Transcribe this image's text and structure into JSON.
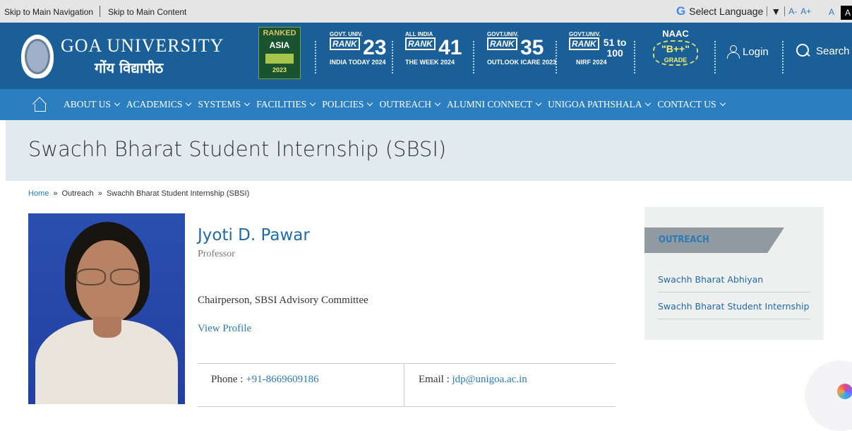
{
  "topbar": {
    "skip_nav": "Skip to Main Navigation",
    "skip_content": "Skip to Main Content",
    "language": "Select Language",
    "language_arrow": "▼",
    "font_small": "A-",
    "font_large": "A+",
    "font_normal": "A",
    "font_dark": "A"
  },
  "header": {
    "university_name": "GOA UNIVERSITY",
    "university_name_hindi": "गोंय विद्यापीठ",
    "rank_asia": {
      "ranked": "RANKED",
      "region": "ASIA",
      "year": "2023"
    },
    "rankings": [
      {
        "top": "GOVT. UNIV.",
        "rank_label": "RANK",
        "value": "23",
        "caption": "INDIA TODAY 2024"
      },
      {
        "top": "ALL INDIA",
        "rank_label": "RANK",
        "value": "41",
        "caption": "THE WEEK 2024"
      },
      {
        "top": "GOVT.UNIV.",
        "rank_label": "RANK",
        "value": "35",
        "caption": "OUTLOOK ICARE 2023"
      },
      {
        "top": "GOVT.UNIV.",
        "rank_label": "RANK",
        "value": "51 to 100",
        "caption": "NIRF 2024"
      }
    ],
    "naac": {
      "title": "NAAC",
      "grade": "\"B++\"",
      "grade_label": "GRADE"
    },
    "login_label": "Login",
    "search_label": "Search"
  },
  "nav": {
    "items": [
      "ABOUT US",
      "ACADEMICS",
      "SYSTEMS",
      "FACILITIES",
      "POLICIES",
      "OUTREACH",
      "ALUMNI CONNECT",
      "UNIGOA PATHSHALA",
      "CONTACT US"
    ]
  },
  "page": {
    "title": "Swachh Bharat Student Internship (SBSI)",
    "breadcrumb": [
      "Home",
      "Outreach",
      "Swachh Bharat Student Internship (SBSI)"
    ],
    "breadcrumb_sep": "»"
  },
  "profile": {
    "name": "Jyoti D. Pawar",
    "designation": "Professor",
    "role": "Chairperson, SBSI Advisory Committee",
    "view_profile": "View Profile",
    "phone_label": "Phone :",
    "phone": "+91-8669609186",
    "email_label": "Email :",
    "email": "jdp@unigoa.ac.in"
  },
  "sidebar": {
    "heading": "OUTREACH",
    "links": [
      "Swachh Bharat Abhiyan",
      "Swachh Bharat Student Internship"
    ]
  },
  "colors": {
    "header_bg": "#1b5f99",
    "nav_bg": "#2b7fc0",
    "link": "#2a7ab8",
    "banner_bg": "#e1ebee"
  }
}
